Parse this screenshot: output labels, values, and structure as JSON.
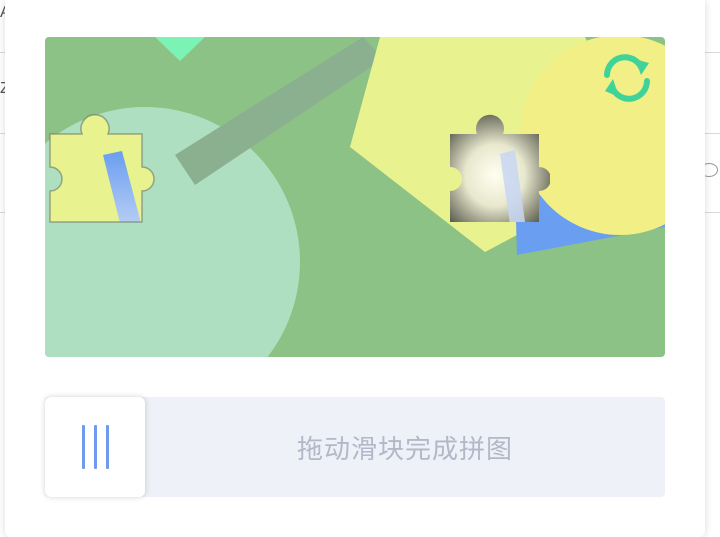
{
  "background": {
    "left_fragments": [
      "A",
      "Z"
    ]
  },
  "captcha": {
    "slider_hint": "拖动滑块完成拼图",
    "refresh_icon": "refresh-icon",
    "handle_icon": "grip-lines-icon",
    "colors": {
      "image_bg": "#8cc285",
      "refresh": "#3fd39a",
      "track": "#eef1f7",
      "hint_text": "#b3b8c8",
      "grip": "#6e9bf0"
    }
  }
}
